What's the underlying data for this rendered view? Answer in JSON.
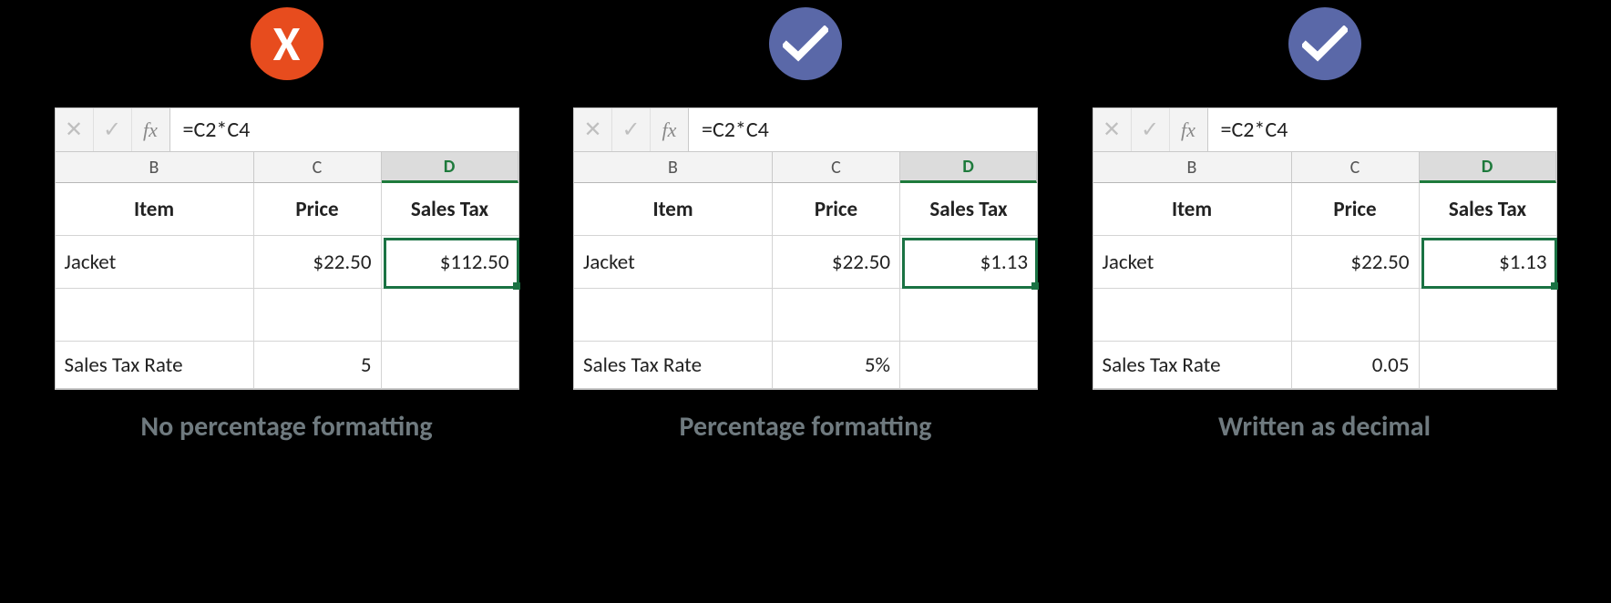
{
  "fx_label": "fx",
  "panels": [
    {
      "status": "x",
      "formula": "=C2*C4",
      "headers": {
        "b": "B",
        "c": "C",
        "d": "D"
      },
      "captions": {
        "item": "Item",
        "price": "Price",
        "tax": "Sales Tax"
      },
      "item": "Jacket",
      "price": "$22.50",
      "tax_result": "$112.50",
      "rate_label": "Sales Tax Rate",
      "rate_value": "5",
      "caption": "No percentage formatting"
    },
    {
      "status": "check",
      "formula": "=C2*C4",
      "headers": {
        "b": "B",
        "c": "C",
        "d": "D"
      },
      "captions": {
        "item": "Item",
        "price": "Price",
        "tax": "Sales Tax"
      },
      "item": "Jacket",
      "price": "$22.50",
      "tax_result": "$1.13",
      "rate_label": "Sales Tax Rate",
      "rate_value": "5%",
      "caption": "Percentage formatting"
    },
    {
      "status": "check",
      "formula": "=C2*C4",
      "headers": {
        "b": "B",
        "c": "C",
        "d": "D"
      },
      "captions": {
        "item": "Item",
        "price": "Price",
        "tax": "Sales Tax"
      },
      "item": "Jacket",
      "price": "$22.50",
      "tax_result": "$1.13",
      "rate_label": "Sales Tax Rate",
      "rate_value": "0.05",
      "caption": "Written as decimal"
    }
  ]
}
